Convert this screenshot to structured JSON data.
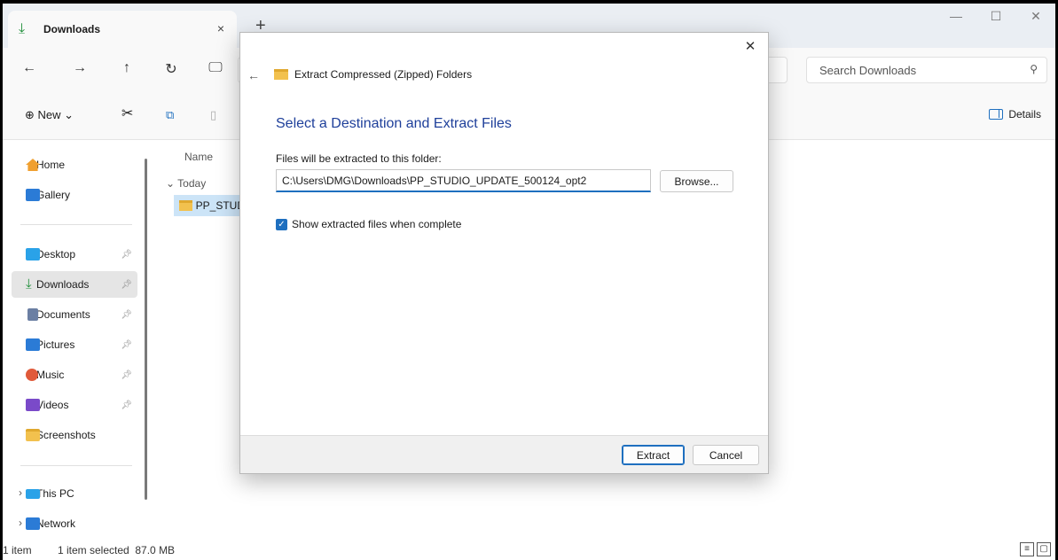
{
  "tab": {
    "title": "Downloads",
    "close": "×",
    "new_tab": "+"
  },
  "window_controls": {
    "minimize": "—",
    "maximize": "☐",
    "close": "✕"
  },
  "nav": {
    "back": "←",
    "forward": "→",
    "up": "↑",
    "refresh": "↻"
  },
  "search": {
    "placeholder": "Search Downloads"
  },
  "commandbar": {
    "new_label": "New",
    "details_label": "Details"
  },
  "sidebar": {
    "items": [
      {
        "label": "Home",
        "icon": "home-icon",
        "color": "#f0a030"
      },
      {
        "label": "Gallery",
        "icon": "gallery-icon",
        "color": "#2b7bd6"
      },
      {
        "label": "Desktop",
        "icon": "desktop-icon",
        "color": "#2aa2e8"
      },
      {
        "label": "Downloads",
        "icon": "downloads-icon",
        "color": "#1f8f3a"
      },
      {
        "label": "Documents",
        "icon": "documents-icon",
        "color": "#6b7fa3"
      },
      {
        "label": "Pictures",
        "icon": "pictures-icon",
        "color": "#2b7bd6"
      },
      {
        "label": "Music",
        "icon": "music-icon",
        "color": "#e05a3a"
      },
      {
        "label": "Videos",
        "icon": "videos-icon",
        "color": "#7a4ac9"
      },
      {
        "label": "Screenshots",
        "icon": "folder-icon",
        "color": "#f2c14e"
      },
      {
        "label": "This PC",
        "icon": "pc-icon",
        "color": "#2aa2e8"
      },
      {
        "label": "Network",
        "icon": "network-icon",
        "color": "#2b7bd6"
      }
    ]
  },
  "filepane": {
    "column_name": "Name",
    "group_today": "Today",
    "file_name": "PP_STUD"
  },
  "status": {
    "count": "1 item",
    "selection": "1 item selected  87.0 MB"
  },
  "dialog": {
    "caption": "Extract Compressed (Zipped) Folders",
    "heading": "Select a Destination and Extract Files",
    "label": "Files will be extracted to this folder:",
    "path_value": "C:\\Users\\DMG\\Downloads\\PP_STUDIO_UPDATE_500124_opt2",
    "browse_label": "Browse...",
    "show_files_label": "Show extracted files when complete",
    "show_files_checked": true,
    "extract_label": "Extract",
    "cancel_label": "Cancel",
    "close": "✕",
    "back": "←"
  },
  "colors": {
    "accent": "#1e6fbf",
    "heading": "#1e3f9a",
    "selection": "#cce4f7"
  }
}
